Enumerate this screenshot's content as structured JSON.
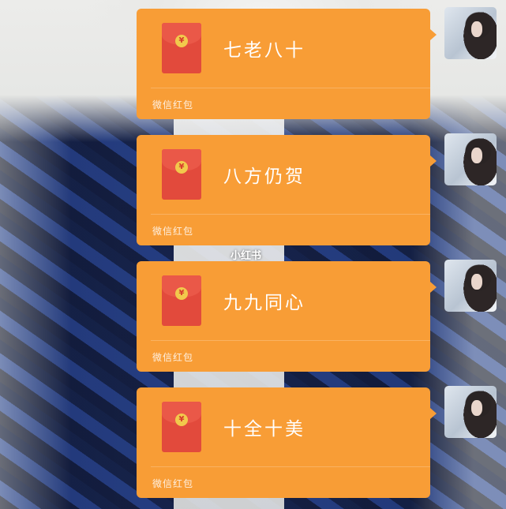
{
  "watermark": "小红书",
  "messages": [
    {
      "greeting": "七老八十",
      "label": "微信红包",
      "icon": "red-envelope-icon"
    },
    {
      "greeting": "八方仍贺",
      "label": "微信红包",
      "icon": "red-envelope-icon"
    },
    {
      "greeting": "九九同心",
      "label": "微信红包",
      "icon": "red-envelope-icon"
    },
    {
      "greeting": "十全十美",
      "label": "微信红包",
      "icon": "red-envelope-icon"
    }
  ],
  "colors": {
    "bubble": "#f89d36",
    "envelope": "#e24a3c",
    "coin": "#f2c94c"
  },
  "envelope_symbol": "¥"
}
